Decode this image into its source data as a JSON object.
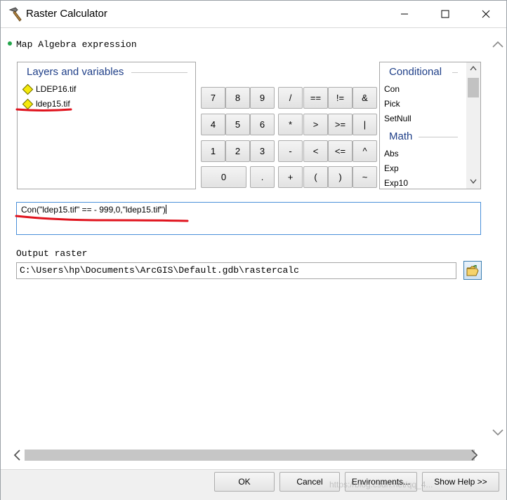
{
  "window": {
    "title": "Raster Calculator",
    "title_icon": "hammer-icon"
  },
  "expression_section": {
    "heading": "Map Algebra expression"
  },
  "layers_panel": {
    "title": "Layers and variables",
    "items": [
      "LDEP16.tif",
      "ldep15.tif"
    ],
    "item_icon": "raster-layer-diamond-icon"
  },
  "calculator": {
    "rows": [
      [
        "7",
        "8",
        "9",
        "/",
        "==",
        "!=",
        "&"
      ],
      [
        "4",
        "5",
        "6",
        "*",
        ">",
        ">=",
        "|"
      ],
      [
        "1",
        "2",
        "3",
        "-",
        "<",
        "<=",
        "^"
      ],
      [
        "0",
        ".",
        "+",
        "(",
        ")",
        "~"
      ]
    ]
  },
  "functions_panel": {
    "groups": [
      {
        "title": "Conditional",
        "items": [
          "Con",
          "Pick",
          "SetNull"
        ]
      },
      {
        "title": "Math",
        "items": [
          "Abs",
          "Exp",
          "Exp10"
        ]
      }
    ]
  },
  "expression_text": "Con(\"ldep15.tif\" ==  - 999,0,\"ldep15.tif\")",
  "output": {
    "label": "Output raster",
    "value": "C:\\Users\\hp\\Documents\\ArcGIS\\Default.gdb\\rastercalc",
    "browse_icon": "open-folder-icon"
  },
  "buttons": {
    "ok": "OK",
    "cancel": "Cancel",
    "environments": "Environments...",
    "show_help": "Show Help >>"
  },
  "watermark": "https://blog.csdn.net/qq_4...",
  "colors": {
    "heading_blue": "#1f3f88",
    "annotation_red": "#e0141e",
    "diamond_yellow": "#f5e90b",
    "focus_blue": "#4a90d9"
  }
}
